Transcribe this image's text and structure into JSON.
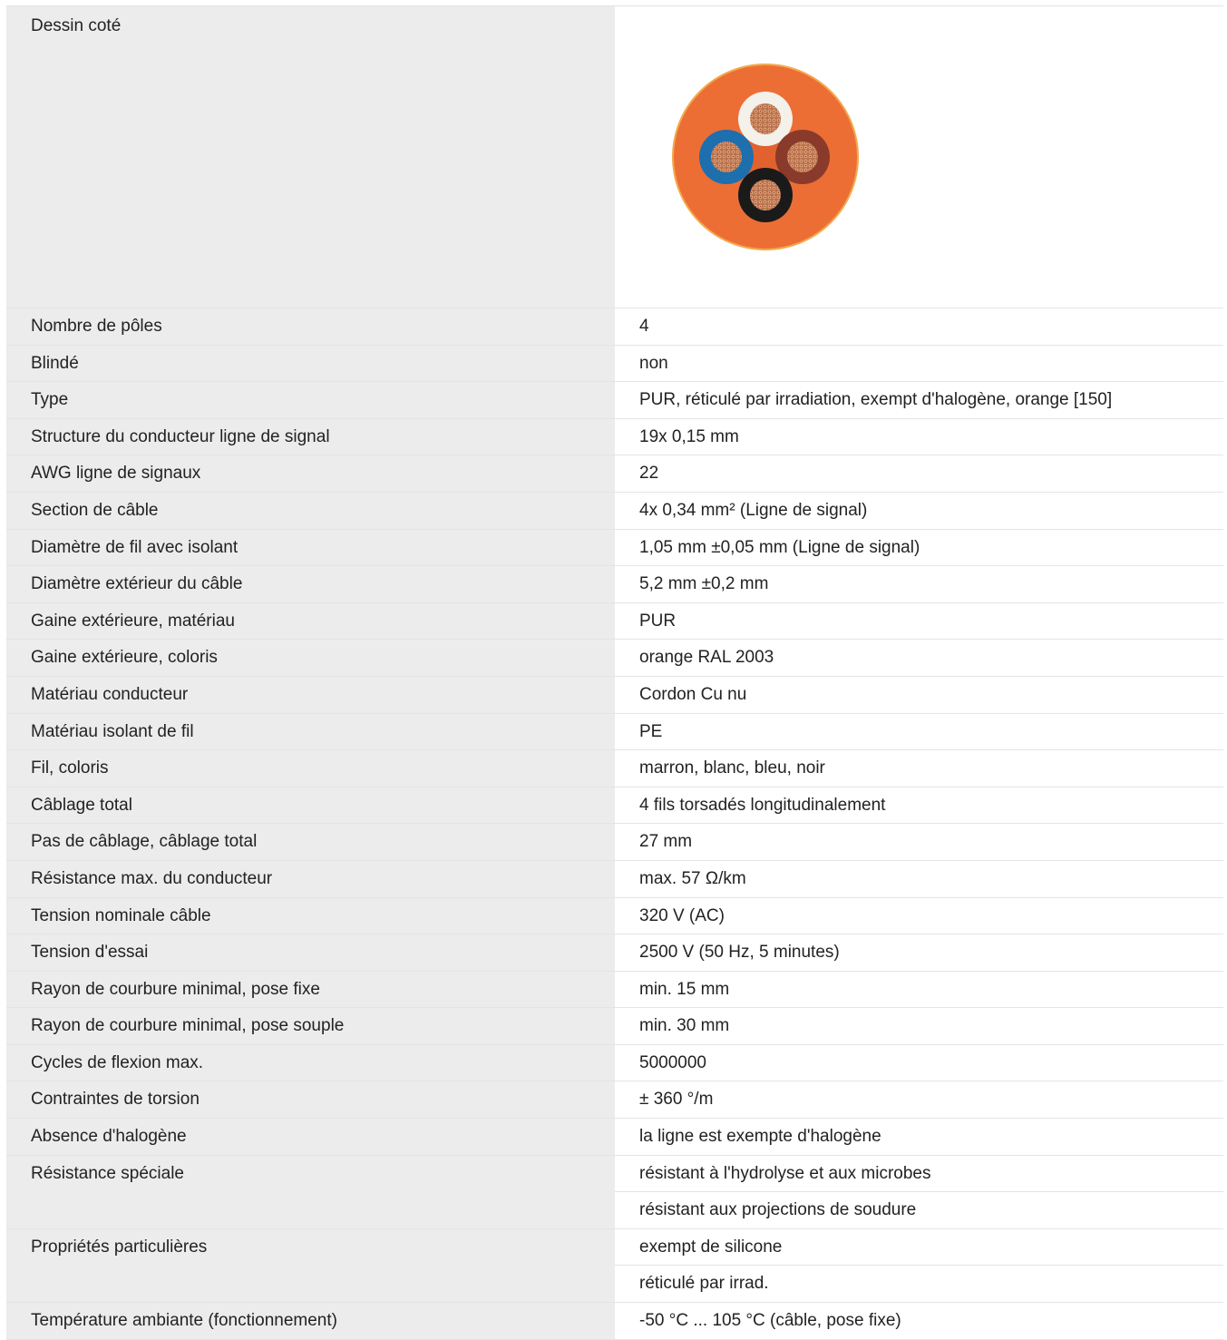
{
  "drawing": {
    "label": "Dessin coté",
    "image": "cable-cross-section-4-pole",
    "colors": {
      "jacket": "#ec6e35",
      "jacket_edge": "#f3a94c",
      "core_white": "#f4f0ea",
      "core_blue": "#1d6fae",
      "core_brown": "#8a3a2a",
      "core_black": "#1a1a1a",
      "copper": "#c6825a"
    }
  },
  "specs": [
    {
      "label": "Nombre de pôles",
      "value": "4"
    },
    {
      "label": "Blindé",
      "value": "non"
    },
    {
      "label": "Type",
      "value": "PUR, réticulé par irradiation, exempt d'halogène, orange [150]"
    },
    {
      "label": "Structure du conducteur ligne de signal",
      "value": "19x 0,15 mm"
    },
    {
      "label": "AWG ligne de signaux",
      "value": "22"
    },
    {
      "label": "Section de câble",
      "value": "4x 0,34 mm² (Ligne de signal)"
    },
    {
      "label": "Diamètre de fil avec isolant",
      "value": "1,05 mm ±0,05 mm (Ligne de signal)"
    },
    {
      "label": "Diamètre extérieur du câble",
      "value": "5,2 mm ±0,2 mm"
    },
    {
      "label": "Gaine extérieure, matériau",
      "value": "PUR"
    },
    {
      "label": "Gaine extérieure, coloris",
      "value": "orange RAL 2003"
    },
    {
      "label": "Matériau conducteur",
      "value": "Cordon Cu nu"
    },
    {
      "label": "Matériau isolant de fil",
      "value": "PE"
    },
    {
      "label": "Fil, coloris",
      "value": "marron, blanc, bleu, noir"
    },
    {
      "label": "Câblage total",
      "value": "4 fils torsadés longitudinalement"
    },
    {
      "label": "Pas de câblage, câblage total",
      "value": "27 mm"
    },
    {
      "label": "Résistance max. du conducteur",
      "value": "max. 57 Ω/km"
    },
    {
      "label": "Tension nominale câble",
      "value": "320 V (AC)"
    },
    {
      "label": "Tension d'essai",
      "value": "2500 V (50 Hz, 5 minutes)"
    },
    {
      "label": "Rayon de courbure minimal, pose fixe",
      "value": "min. 15 mm"
    },
    {
      "label": "Rayon de courbure minimal, pose souple",
      "value": "min. 30 mm"
    },
    {
      "label": "Cycles de flexion max.",
      "value": "5000000"
    },
    {
      "label": "Contraintes de torsion",
      "value": "± 360 °/m"
    },
    {
      "label": "Absence d'halogène",
      "value": "la ligne est exempte d'halogène"
    },
    {
      "label": "Résistance spéciale",
      "value": "résistant à l'hydrolyse et aux microbes"
    },
    {
      "label": "",
      "value": "résistant aux projections de soudure"
    },
    {
      "label": "Propriétés particulières",
      "value": "exempt de silicone"
    },
    {
      "label": "",
      "value": "réticulé par irrad."
    },
    {
      "label": "Température ambiante (fonctionnement)",
      "value": "-50 °C ... 105 °C (câble, pose fixe)"
    }
  ]
}
